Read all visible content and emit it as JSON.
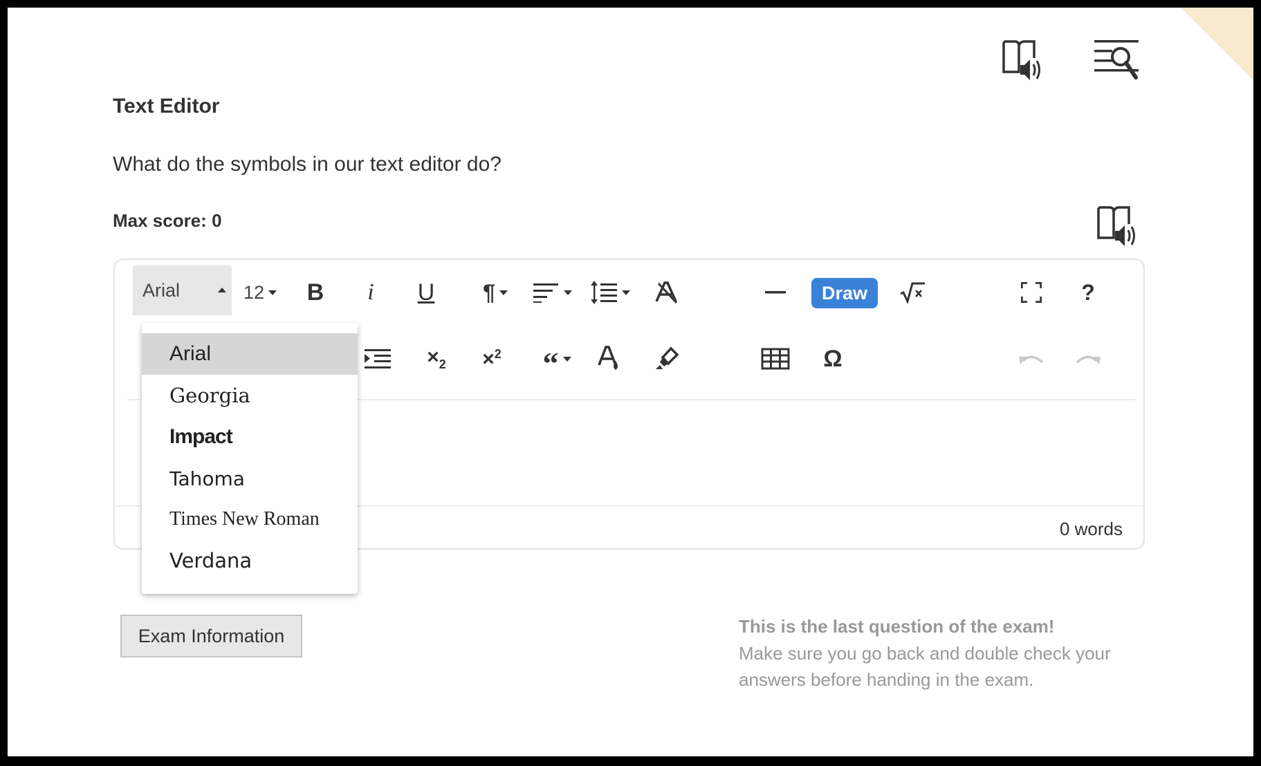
{
  "question": {
    "title": "Text Editor",
    "text": "What do the symbols in our text editor do?",
    "max_score": "Max score: 0"
  },
  "toolbar": {
    "font_family": "Arial",
    "font_size": "12",
    "draw_label": "Draw",
    "help_label": "?"
  },
  "font_dropdown": {
    "options": [
      {
        "label": "Arial",
        "selected": true
      },
      {
        "label": "Georgia",
        "selected": false
      },
      {
        "label": "Impact",
        "selected": false
      },
      {
        "label": "Tahoma",
        "selected": false
      },
      {
        "label": "Times New Roman",
        "selected": false
      },
      {
        "label": "Verdana",
        "selected": false
      }
    ]
  },
  "editor": {
    "word_count": "0 words"
  },
  "footer": {
    "exam_info_label": "Exam Information",
    "last_question_title": "This is the last question of the exam!",
    "last_question_line1": "Make sure you go back and double check your",
    "last_question_line2": "answers before handing in the exam."
  },
  "colors": {
    "draw_button": "#3a82d8",
    "selected_option": "#d6d6d6",
    "corner_fold": "#f8ebce"
  }
}
